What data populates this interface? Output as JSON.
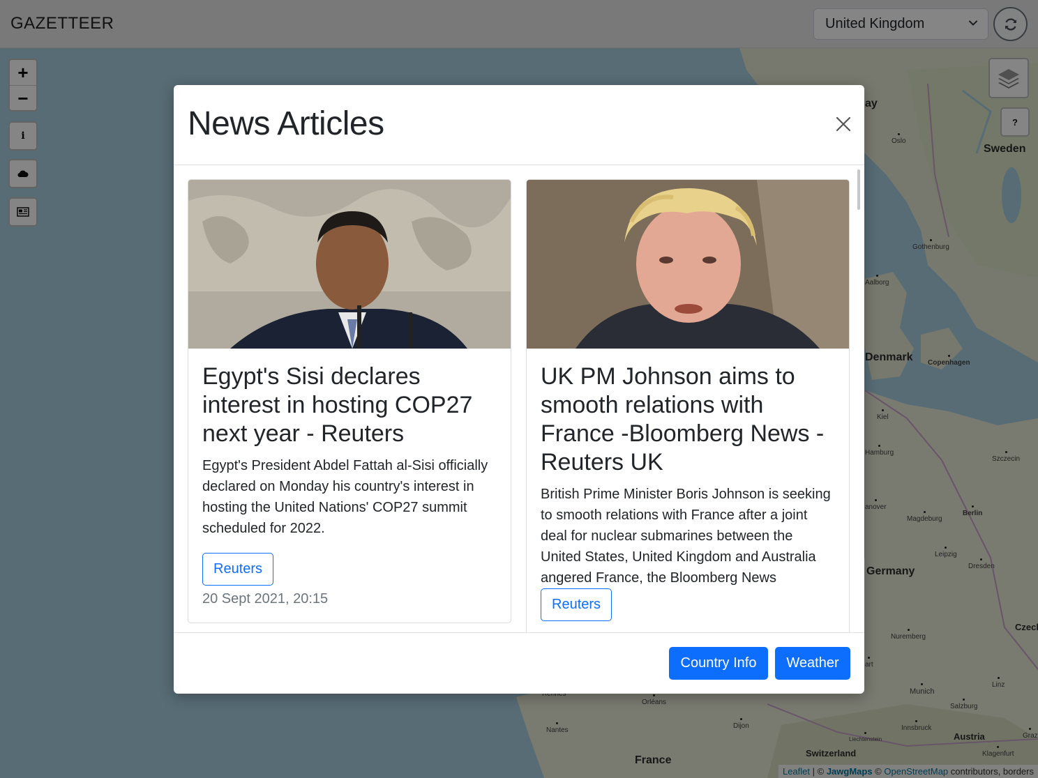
{
  "navbar": {
    "brand": "GAZETTEER",
    "country_selected": "United Kingdom"
  },
  "map": {
    "controls": {
      "zoom_in": "+",
      "zoom_out": "−",
      "info_icon": "info-icon",
      "weather_icon": "cloud-icon",
      "news_icon": "newspaper-icon",
      "help": "?"
    },
    "labels": {
      "oslo": "Oslo",
      "sweden": "Sweden",
      "gothenburg": "Gothenburg",
      "aalborg": "Aalborg",
      "denmark": "Denmark",
      "copenhagen": "Copenhagen",
      "kiel": "Kiel",
      "hamburg": "Hamburg",
      "szczecin": "Szczecin",
      "hanover": "anover",
      "magdeburg": "Magdeburg",
      "berlin": "Berlin",
      "leipzig": "Leipzig",
      "dresden": "Dresden",
      "germany": "Germany",
      "czech": "Czech",
      "nuremberg": "Nuremberg",
      "stuttgart": "art",
      "munich": "Munich",
      "linz": "Linz",
      "salzburg": "Salzburg",
      "innsbruck": "Innsbruck",
      "austria": "Austria",
      "graz": "Graz",
      "klagenfurt": "Klagenfurt",
      "rennes": "Rennes",
      "orleans": "Orléans",
      "nantes": "Nantes",
      "dijon": "Dijon",
      "liechtenstein": "Liechtenstein",
      "switzerland": "Switzerland",
      "france": "France",
      "norway_fragment": "ay"
    },
    "attribution": {
      "leaflet": "Leaflet",
      "sep": " | © ",
      "jawg": "JawgMaps",
      "copy2": " © ",
      "osm": "OpenStreetMap",
      "rest": " contributors, borders"
    },
    "colors": {
      "sea": "#a9cfe0",
      "land": "#e8ead6"
    }
  },
  "modal": {
    "title": "News Articles",
    "articles": [
      {
        "title": "Egypt's Sisi declares interest in hosting COP27 next year - Reuters",
        "description": "Egypt's President Abdel Fattah al-Sisi officially declared on Monday his country's interest in hosting the United Nations' COP27 summit scheduled for 2022.",
        "source": "Reuters",
        "date": "20 Sept 2021, 20:15"
      },
      {
        "title": "UK PM Johnson aims to smooth relations with France -Bloomberg News - Reuters UK",
        "description": "British Prime Minister Boris Johnson is seeking to smooth relations with France after a joint deal for nuclear submarines between the United States, United Kingdom and Australia angered France, the Bloomberg News",
        "source": "Reuters"
      }
    ],
    "footer": {
      "country_info": "Country Info",
      "weather": "Weather"
    },
    "colors": {
      "primary": "#0d6efd",
      "muted": "#6c757d"
    }
  }
}
